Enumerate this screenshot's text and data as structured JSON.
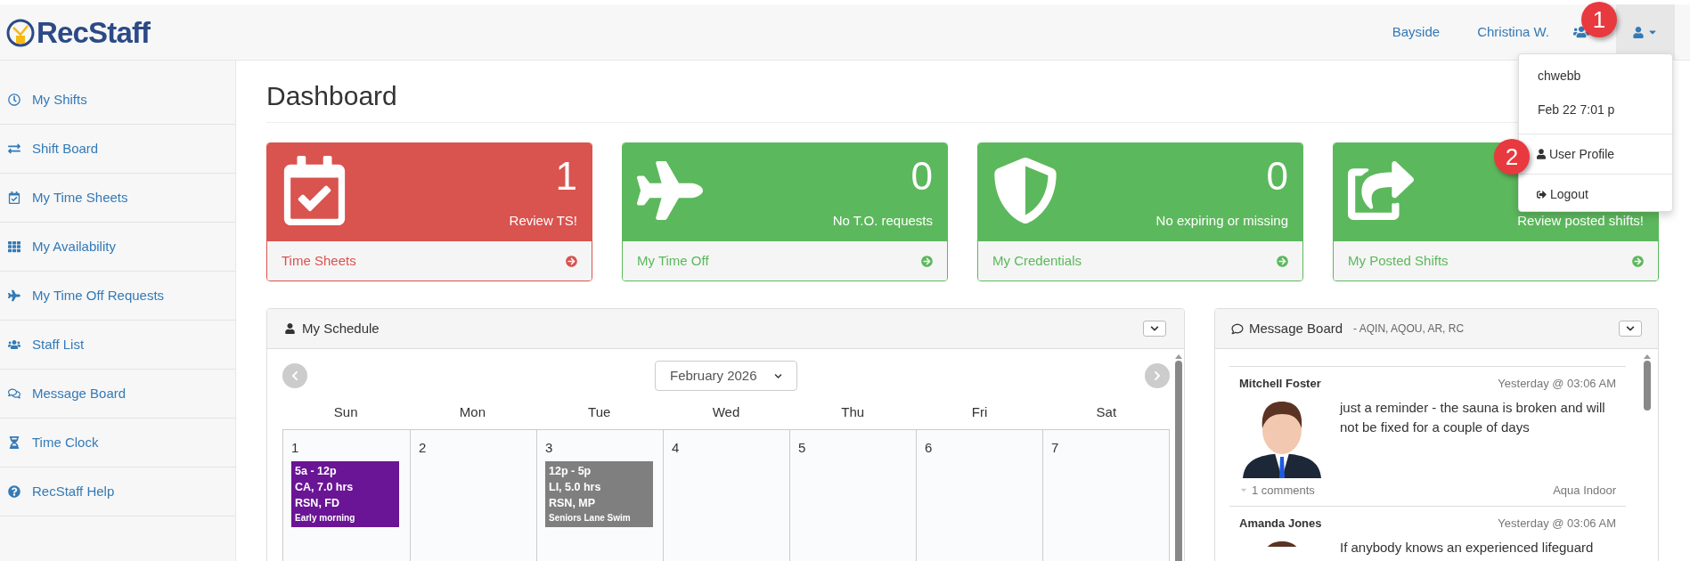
{
  "logo": {
    "text": "RecStaff"
  },
  "header": {
    "links": [
      "Bayside",
      "Christina W."
    ]
  },
  "user_menu": {
    "expanded": true,
    "items": [
      {
        "kind": "info",
        "label": "chwebb"
      },
      {
        "kind": "info",
        "label": "Feb 22 7:01 p"
      },
      {
        "kind": "link",
        "label": "User Profile"
      },
      {
        "kind": "link",
        "label": "Logout"
      }
    ]
  },
  "annotations": [
    {
      "label": "1"
    },
    {
      "label": "2"
    }
  ],
  "sidebar": {
    "items": [
      "My Shifts",
      "Shift Board",
      "My Time Sheets",
      "My Availability",
      "My Time Off Requests",
      "Staff List",
      "Message Board",
      "Time Clock",
      "RecStaff Help"
    ]
  },
  "page_title": "Dashboard",
  "cards": [
    {
      "kind": "alert",
      "count": "1",
      "message": "Review TS!",
      "link": "Time Sheets"
    },
    {
      "kind": "ok",
      "count": "0",
      "message": "No T.O. requests",
      "link": "My Time Off"
    },
    {
      "kind": "ok",
      "count": "0",
      "message": "No expiring or missing",
      "link": "My Credentials"
    },
    {
      "kind": "ok",
      "message": "Review posted shifts!",
      "link": "My Posted Shifts"
    }
  ],
  "schedule": {
    "title": "My Schedule",
    "month": "February 2026",
    "weekdays": [
      "Sun",
      "Mon",
      "Tue",
      "Wed",
      "Thu",
      "Fri",
      "Sat"
    ],
    "days": [
      {
        "date": "1",
        "events": [
          {
            "lines": [
              "5a - 12p",
              "CA, 7.0 hrs",
              "RSN, FD"
            ],
            "note": "Early morning",
            "color": "#6a1595"
          }
        ]
      },
      {
        "date": "2"
      },
      {
        "date": "3",
        "events": [
          {
            "lines": [
              "12p - 5p",
              "LI, 5.0 hrs",
              "RSN, MP"
            ],
            "note": "Seniors Lane Swim",
            "color": "#7f7f7f"
          }
        ]
      },
      {
        "date": "4"
      },
      {
        "date": "5"
      },
      {
        "date": "6"
      },
      {
        "date": "7"
      }
    ]
  },
  "message_board": {
    "title": "Message Board",
    "groups": "- AQIN, AQOU, AR, RC",
    "posts": [
      {
        "author": "Mitchell Foster",
        "time": "Yesterday @ 03:06 AM",
        "text": "just a reminder - the sauna is broken and will not be fixed for a couple of days",
        "comments": "1 comments",
        "location": "Aqua Indoor"
      },
      {
        "author": "Amanda Jones",
        "time": "Yesterday @ 03:06 AM",
        "text": "If anybody knows an experienced lifeguard"
      }
    ]
  }
}
